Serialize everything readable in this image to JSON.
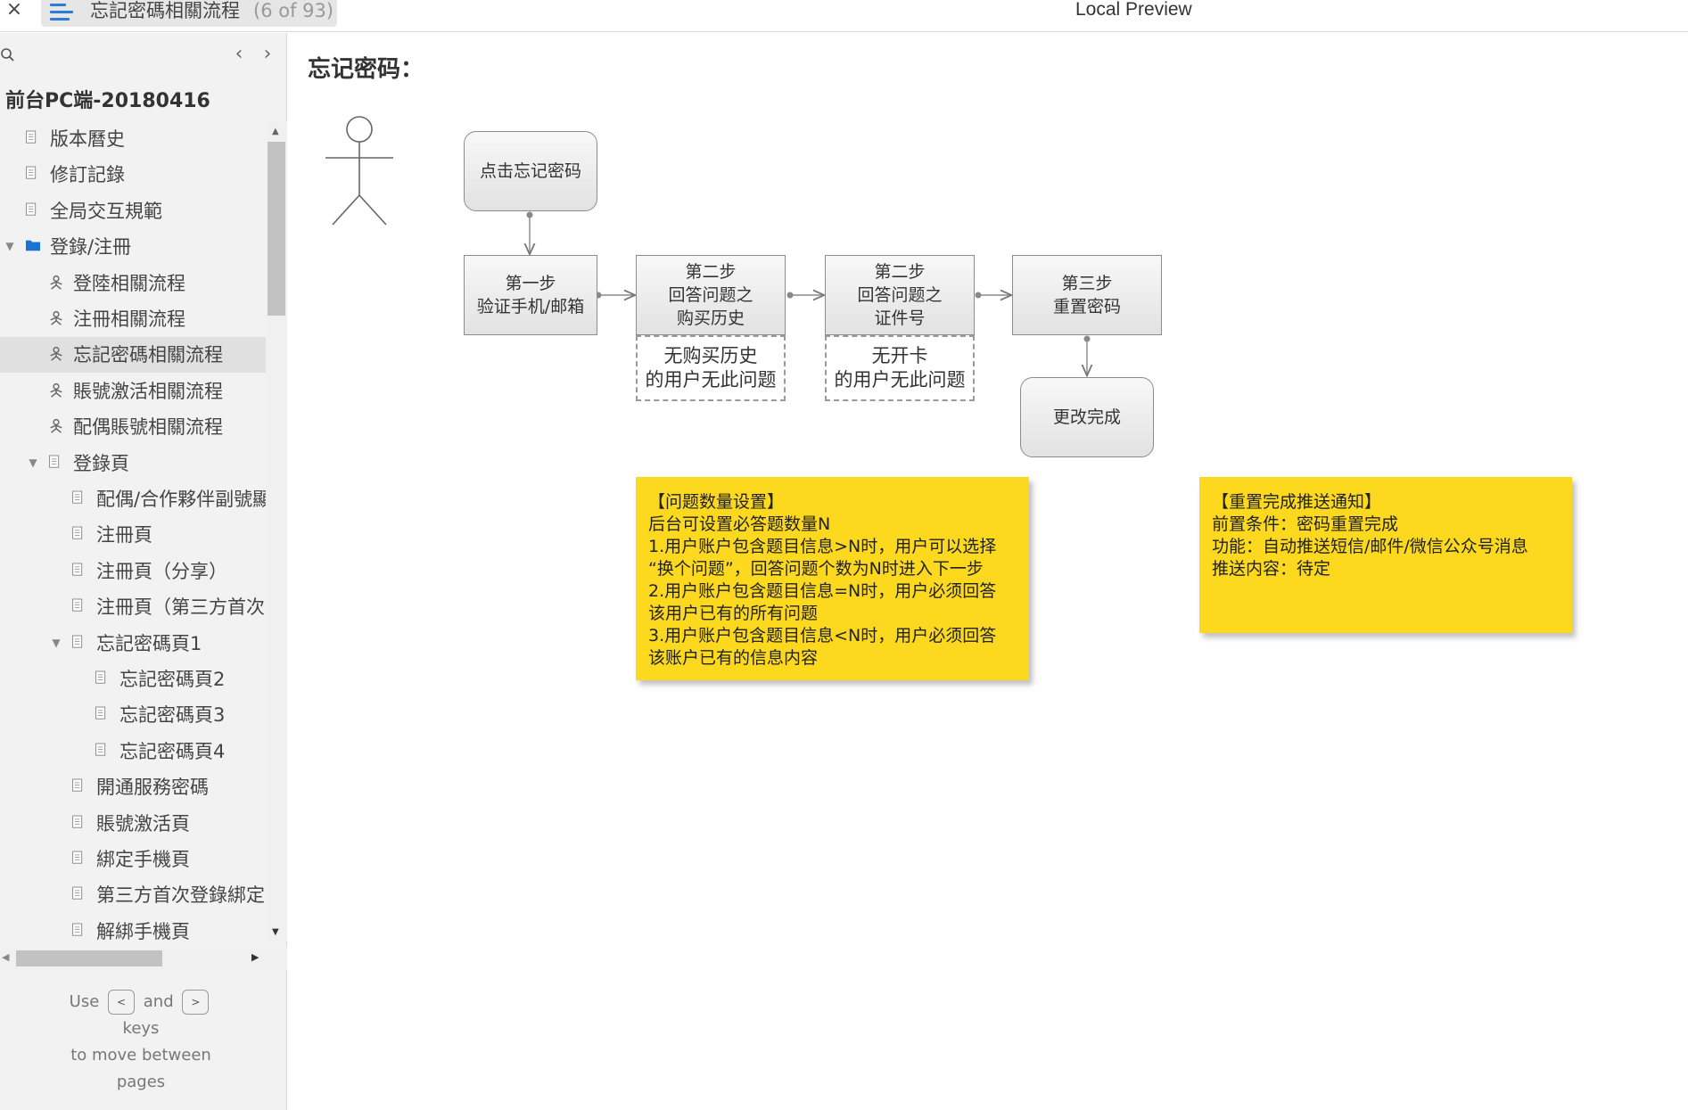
{
  "topbar": {
    "close_label": "×",
    "tab_title": "忘記密碼相關流程",
    "tab_count": "(6 of 93)",
    "preview_title": "Local Preview"
  },
  "sidebar": {
    "prev_label": "‹",
    "next_label": "›",
    "project_title": "前台PC端-20180416",
    "items": [
      {
        "label": "版本曆史",
        "icon": "page-icon"
      },
      {
        "label": "修訂記錄",
        "icon": "page-icon"
      },
      {
        "label": "全局交互規範",
        "icon": "page-icon"
      },
      {
        "label": "登錄/注冊",
        "icon": "folder-icon"
      },
      {
        "label": "登陸相關流程",
        "icon": "flow-icon"
      },
      {
        "label": "注冊相關流程",
        "icon": "flow-icon"
      },
      {
        "label": "忘記密碼相關流程",
        "icon": "flow-icon"
      },
      {
        "label": "賬號激活相關流程",
        "icon": "flow-icon"
      },
      {
        "label": "配偶賬號相關流程",
        "icon": "flow-icon"
      },
      {
        "label": "登錄頁",
        "icon": "page-icon"
      },
      {
        "label": "配偶/合作夥伴副號顯",
        "icon": "page-icon"
      },
      {
        "label": "注冊頁",
        "icon": "page-icon"
      },
      {
        "label": "注冊頁（分享）",
        "icon": "page-icon"
      },
      {
        "label": "注冊頁（第三方首次",
        "icon": "page-icon"
      },
      {
        "label": "忘記密碼頁1",
        "icon": "page-icon"
      },
      {
        "label": "忘記密碼頁2",
        "icon": "page-icon"
      },
      {
        "label": "忘記密碼頁3",
        "icon": "page-icon"
      },
      {
        "label": "忘記密碼頁4",
        "icon": "page-icon"
      },
      {
        "label": "開通服務密碼",
        "icon": "page-icon"
      },
      {
        "label": "賬號激活頁",
        "icon": "page-icon"
      },
      {
        "label": "綁定手機頁",
        "icon": "page-icon"
      },
      {
        "label": "第三方首次登錄綁定",
        "icon": "page-icon"
      },
      {
        "label": "解綁手機頁",
        "icon": "page-icon"
      }
    ],
    "selected_index": 6,
    "hint": {
      "use": "Use",
      "and": "and",
      "keys": "keys",
      "line2": "to move between",
      "line3": "pages",
      "key_prev": "<",
      "key_next": ">"
    }
  },
  "main": {
    "heading": "忘记密码：",
    "flow": {
      "start": "点击忘记密码",
      "step1": "第一步\n验证手机/邮箱",
      "step2a": "第二步\n回答问题之\n购买历史",
      "step2b": "第二步\n回答问题之\n证件号",
      "step3": "第三步\n重置密码",
      "done": "更改完成",
      "note_a": "无购买历史\n的用户无此问题",
      "note_b": "无开卡\n的用户无此问题"
    },
    "sticky1": {
      "lines": [
        "【问题数量设置】",
        "后台可设置必答题数量N",
        "1.用户账户包含题目信息>N时，用户可以选择",
        "“换个问题”，回答问题个数为N时进入下一步",
        "2.用户账户包含题目信息=N时，用户必须回答",
        "该用户已有的所有问题",
        "3.用户账户包含题目信息<N时，用户必须回答",
        "该账户已有的信息内容"
      ]
    },
    "sticky2": {
      "lines": [
        "【重置完成推送通知】",
        "前置条件：密码重置完成",
        "功能：自动推送短信/邮件/微信公众号消息",
        "推送内容：待定"
      ]
    }
  },
  "colors": {
    "accent": "#2f7bd8",
    "sticky": "#fcd91f",
    "selected_row": "#e0e0e0"
  }
}
